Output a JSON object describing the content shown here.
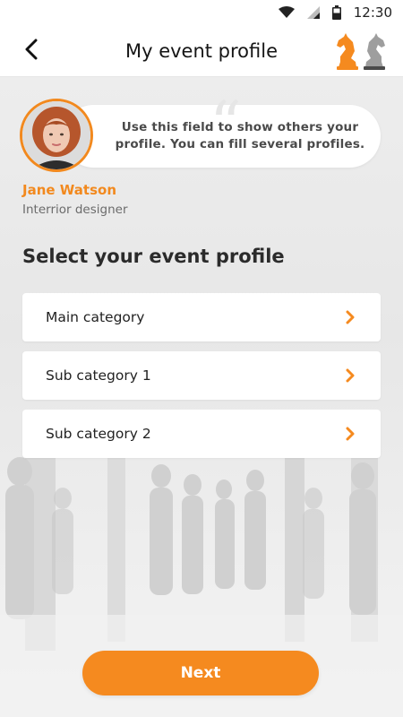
{
  "status_bar": {
    "time": "12:30",
    "icons": [
      "wifi-icon",
      "signal-icon",
      "battery-icon"
    ]
  },
  "app_bar": {
    "title": "My event profile",
    "back_icon": "chevron-left-icon",
    "logo": "knight-logo"
  },
  "profile": {
    "name": "Jane Watson",
    "role": "Interrior designer",
    "hint": "Use this field to show others your profile. You can fill several profiles."
  },
  "section": {
    "title": "Select your event profile"
  },
  "categories": [
    {
      "label": "Main category"
    },
    {
      "label": "Sub category 1"
    },
    {
      "label": "Sub category 2"
    }
  ],
  "actions": {
    "next_label": "Next"
  },
  "colors": {
    "accent": "#f58a1f",
    "text_dark": "#222222",
    "text_muted": "#6b6b6b"
  }
}
